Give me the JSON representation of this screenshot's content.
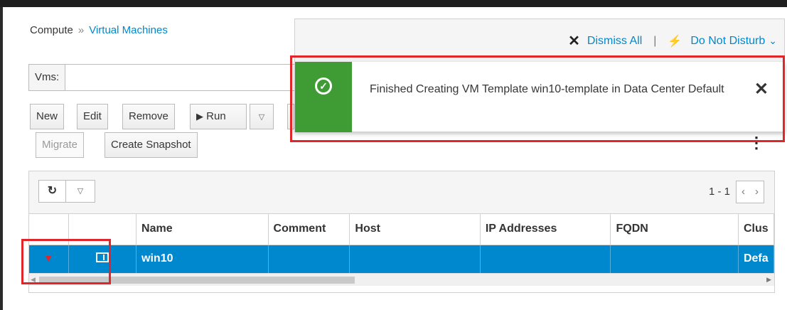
{
  "breadcrumb": {
    "root": "Compute",
    "separator": "»",
    "current": "Virtual Machines"
  },
  "search": {
    "label": "Vms:",
    "value": ""
  },
  "toolbar": {
    "new_label": "New",
    "edit_label": "Edit",
    "remove_label": "Remove",
    "run_label": "Run",
    "run_icon": "play-icon",
    "caret": "▽",
    "migrate_label": "Migrate",
    "create_snapshot_label": "Create Snapshot"
  },
  "drawer": {
    "dismiss_all_label": "Dismiss All",
    "separator": "|",
    "do_not_disturb_label": "Do Not Disturb",
    "dnd_caret": "⌄"
  },
  "toast": {
    "status": "success",
    "message": "Finished Creating VM Template win10-template in Data Center Default",
    "close_glyph": "✕",
    "check_glyph": "✓"
  },
  "grid": {
    "refresh_glyph": "↻",
    "pagination": "1 - 1",
    "prev_glyph": "‹",
    "next_glyph": "›",
    "columns": [
      "",
      "",
      "Name",
      "Comment",
      "Host",
      "IP Addresses",
      "FQDN",
      "Clus"
    ],
    "rows": [
      {
        "expander": "▼",
        "type_icon": "vm-icon",
        "name": "win10",
        "comment": "",
        "host": "",
        "ip": "",
        "fqdn": "",
        "cluster": "Defa"
      }
    ]
  },
  "colors": {
    "accent": "#0088ce",
    "success": "#3f9c35",
    "highlight": "#e0262a"
  }
}
